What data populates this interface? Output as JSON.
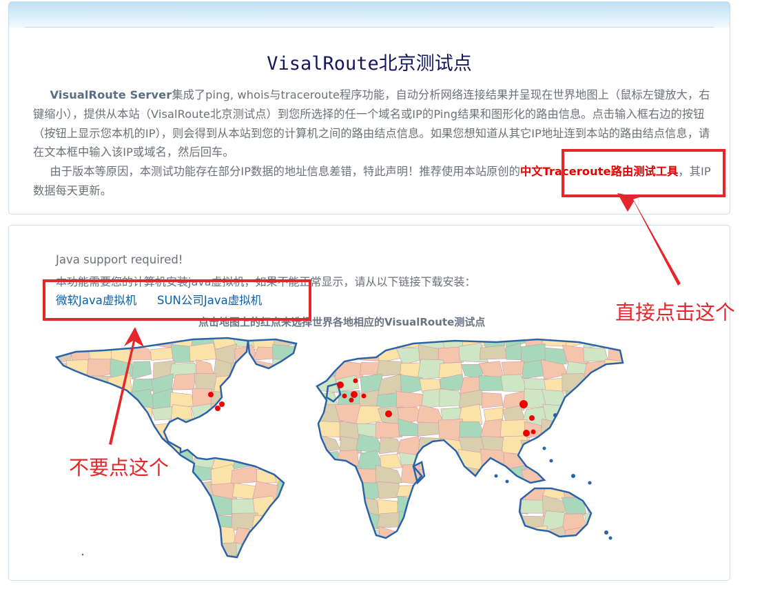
{
  "header": {
    "title": "VisalRoute北京测试点"
  },
  "intro": {
    "bold_lead": "VisualRoute Server",
    "para1_rest": "集成了ping, whois与traceroute程序功能，自动分析网络连接结果并呈现在世界地图上（鼠标左键放大，右键缩小），提供从本站（VisalRoute北京测试点）到您所选择的任一个域名或IP的Ping结果和图形化的路由信息。点击输入框右边的按钮（按钮上显示您本机的IP），则会得到从本站到您的计算机之间的路由结点信息。如果您想知道从其它IP地址连到本站的路由结点信息，请在文本框中输入该IP或域名，然后回车。",
    "para2_pre": "由于版本等原因，本测试功能存在部分IP数据的地址信息差错，特此声明！推荐使用本站原创的",
    "tool_link": "中文Traceroute路由测试工具",
    "para2_post": "，其IP数据每天更新。"
  },
  "java": {
    "required": "Java support required!",
    "note": "本功能需要您的计算机安装java虚拟机，如果不能正常显示，请从以下链接下载安装：",
    "link_microsoft": "微软Java虚拟机",
    "link_sun": "SUN公司Java虚拟机"
  },
  "map": {
    "caption": "点击地图上的红点来选择世界各地相应的VisualRoute测试点",
    "colors": {
      "ocean": "#ffffff",
      "coast": "#2a62a8",
      "land": [
        "#a8d8bc",
        "#f4c4ac",
        "#fbe2a8",
        "#d9cfae",
        "#cfe6c4"
      ],
      "marker": "#ee0000"
    }
  },
  "annotations": {
    "click_this": "直接点击这个",
    "dont_click": "不要点这个",
    "color": "#e5262b"
  }
}
